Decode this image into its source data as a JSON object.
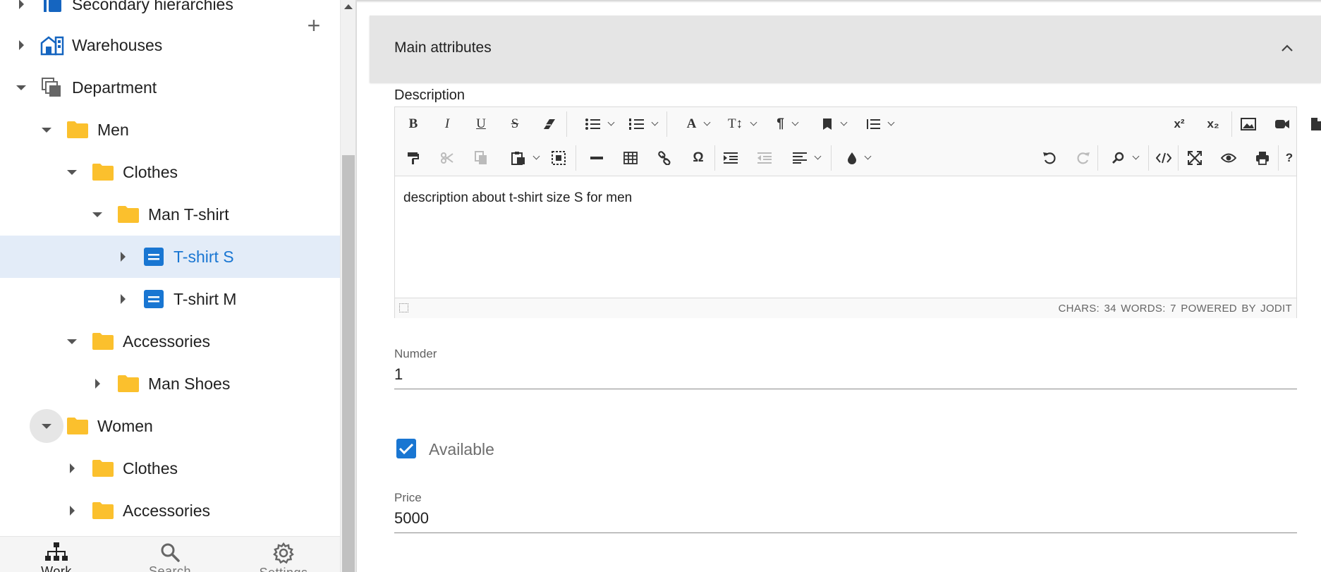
{
  "tree": {
    "add_label": "+",
    "items": [
      {
        "label": "Secondary hierarchies",
        "icon": "hierarchy-icon"
      },
      {
        "label": "Warehouses",
        "icon": "warehouse-icon"
      },
      {
        "label": "Department",
        "icon": "department-icon"
      },
      {
        "label": "Men",
        "icon": "folder-icon"
      },
      {
        "label": "Clothes",
        "icon": "folder-icon"
      },
      {
        "label": "Man T-shirt",
        "icon": "folder-icon"
      },
      {
        "label": "T-shirt S",
        "icon": "item-icon",
        "selected": true
      },
      {
        "label": "T-shirt M",
        "icon": "item-icon"
      },
      {
        "label": "Accessories",
        "icon": "folder-icon"
      },
      {
        "label": "Man Shoes",
        "icon": "folder-icon"
      },
      {
        "label": "Women",
        "icon": "folder-icon"
      },
      {
        "label": "Clothes",
        "icon": "folder-icon"
      },
      {
        "label": "Accessories",
        "icon": "folder-icon"
      }
    ]
  },
  "bottom_nav": [
    {
      "label": "Work",
      "icon": "sitemap-icon",
      "active": true
    },
    {
      "label": "Search",
      "icon": "search-icon"
    },
    {
      "label": "Settings",
      "icon": "gear-icon"
    }
  ],
  "panel": {
    "title": "Main attributes"
  },
  "description": {
    "label": "Description",
    "content": "description about t-shirt size S for men",
    "status": "CHARS: 34   WORDS: 7   POWERED BY JODIT"
  },
  "toolbar": {
    "row1": [
      "bold",
      "italic",
      "underline",
      "strikethrough",
      "eraser",
      "unordered-list",
      "ordered-list",
      "font",
      "font-size",
      "paragraph",
      "classes",
      "line-height",
      "superscript",
      "subscript",
      "image",
      "video",
      "file"
    ],
    "row2": [
      "copy-format",
      "cut",
      "copy",
      "paste",
      "select-all",
      "horizontal-rule",
      "table",
      "link",
      "symbols",
      "indent",
      "outdent",
      "align",
      "brush",
      "undo",
      "redo",
      "find",
      "source",
      "fullsize",
      "preview",
      "print",
      "about"
    ],
    "glyphs": {
      "bold": "B",
      "italic": "I",
      "underline": "U",
      "strikethrough": "S",
      "superscript": "x²",
      "subscript": "x₂",
      "font": "A",
      "font_size": "T↕",
      "paragraph": "¶",
      "symbols": "Ω",
      "about": "?"
    }
  },
  "fields": {
    "number_label": "Numder",
    "number_value": "1",
    "available_label": "Available",
    "available_checked": true,
    "price_label": "Price",
    "price_value": "5000"
  },
  "colors": {
    "accent": "#1976d2",
    "folder": "#fbc02d",
    "selected_row": "#e3ecf8",
    "header_bg": "#e5e5e5"
  }
}
